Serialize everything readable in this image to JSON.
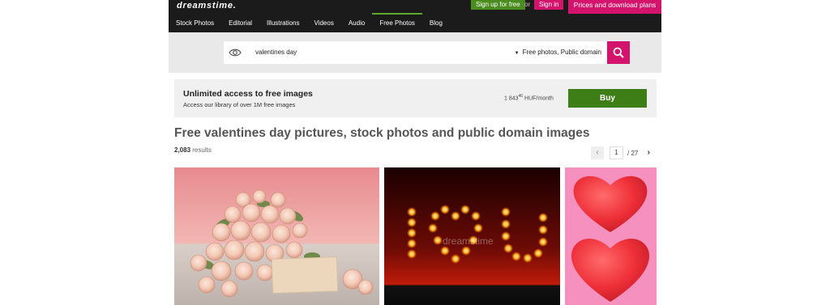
{
  "header": {
    "logo": "dreamstime.",
    "signup_label": "Sign up for free",
    "or_label": "or",
    "signin_label": "Sign in",
    "prices_label": "Prices and download plans"
  },
  "nav": {
    "items": [
      {
        "label": "Stock Photos"
      },
      {
        "label": "Editorial"
      },
      {
        "label": "Illustrations"
      },
      {
        "label": "Videos"
      },
      {
        "label": "Audio"
      },
      {
        "label": "Free Photos",
        "active": true
      },
      {
        "label": "Blog"
      }
    ]
  },
  "search": {
    "query": "valentines day",
    "filter_label": "Free photos, Public domain",
    "icon": "search-icon"
  },
  "promo": {
    "title": "Unlimited access to free images",
    "subtitle": "Access our library of over 1M free images",
    "price_main": "1 843",
    "price_sup": "46",
    "price_unit": "HUF/month",
    "buy_label": "Buy"
  },
  "main": {
    "heading": "Free valentines day pictures, stock photos and public domain images",
    "results_count": "2,083",
    "results_label": "results"
  },
  "pager": {
    "prev": "‹",
    "page": "1",
    "total": "/ 27",
    "next": "›"
  },
  "images": {
    "watermark": "dreamstime"
  },
  "colors": {
    "brand_pink": "#d4136d",
    "brand_green": "#3e7e16",
    "header_bg": "#1b1b1b"
  }
}
